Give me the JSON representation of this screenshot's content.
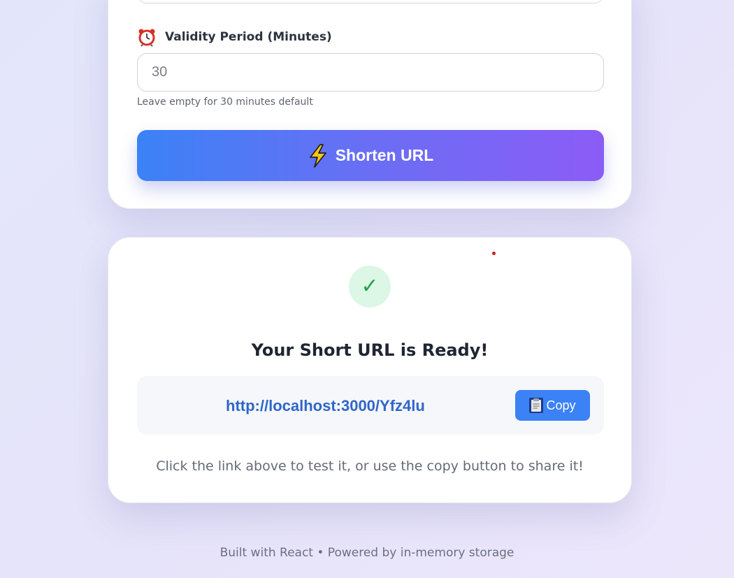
{
  "form": {
    "validity_label": "Validity Period (Minutes)",
    "validity_placeholder": "30",
    "validity_value": "",
    "validity_hint": "Leave empty for 30 minutes default",
    "submit_label": "Shorten URL",
    "clock_icon": "alarm-clock-icon",
    "bolt_icon": "lightning-bolt-icon"
  },
  "result": {
    "check_icon": "✓",
    "title": "Your Short URL is Ready!",
    "short_url": "http://localhost:3000/Yfz4lu",
    "copy_label": "Copy",
    "clipboard_icon": "clipboard-icon",
    "hint": "Click the link above to test it, or use the copy button to share it!"
  },
  "footer": {
    "text": "Built with React • Powered by in-memory storage"
  },
  "colors": {
    "accent_start": "#3b82f6",
    "accent_end": "#8b5cf6",
    "success": "#22a34b",
    "link": "#2e66c9"
  }
}
